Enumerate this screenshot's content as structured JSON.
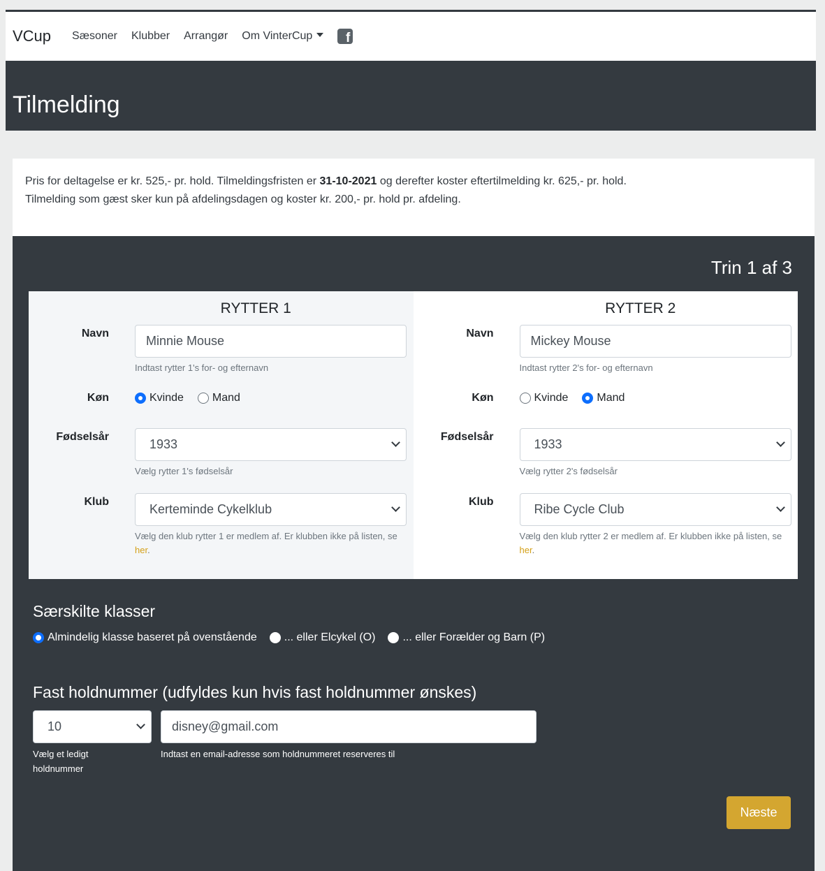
{
  "nav": {
    "brand": "VCup",
    "links": [
      "Sæsoner",
      "Klubber",
      "Arrangør",
      "Om VinterCup"
    ]
  },
  "page_title": "Tilmelding",
  "info": {
    "line1_pre": "Pris for deltagelse er kr. 525,- pr. hold. Tilmeldingsfristen er ",
    "deadline": "31-10-2021",
    "line1_post": " og derefter koster eftertilmelding kr. 625,- pr. hold.",
    "line2": "Tilmelding som gæst sker kun på afdelingsdagen og koster kr. 200,- pr. hold pr. afdeling."
  },
  "step": "Trin 1 af 3",
  "riders": [
    {
      "title": "RYTTER 1",
      "name_label": "Navn",
      "name_value": "Minnie Mouse",
      "name_help": "Indtast rytter 1's for- og efternavn",
      "gender_label": "Køn",
      "gender_options": [
        "Kvinde",
        "Mand"
      ],
      "gender_selected": "Kvinde",
      "year_label": "Fødselsår",
      "year_value": "1933",
      "year_help": "Vælg rytter 1's fødselsår",
      "club_label": "Klub",
      "club_value": "Kerteminde Cykelklub",
      "club_help_pre": "Vælg den klub rytter 1 er medlem af. Er klubben ikke på listen, se ",
      "club_help_link": "her",
      "club_help_post": "."
    },
    {
      "title": "RYTTER 2",
      "name_label": "Navn",
      "name_value": "Mickey Mouse",
      "name_help": "Indtast rytter 2's for- og efternavn",
      "gender_label": "Køn",
      "gender_options": [
        "Kvinde",
        "Mand"
      ],
      "gender_selected": "Mand",
      "year_label": "Fødselsår",
      "year_value": "1933",
      "year_help": "Vælg rytter 2's fødselsår",
      "club_label": "Klub",
      "club_value": "Ribe Cycle Club",
      "club_help_pre": "Vælg den klub rytter 2 er medlem af. Er klubben ikke på listen, se ",
      "club_help_link": "her",
      "club_help_post": "."
    }
  ],
  "classes": {
    "title": "Særskilte klasser",
    "options": [
      "Almindelig klasse baseret på ovenstående",
      "... eller Elcykel (O)",
      "... eller Forælder og Barn (P)"
    ],
    "selected": "Almindelig klasse baseret på ovenstående"
  },
  "team_number": {
    "title": "Fast holdnummer (udfyldes kun hvis fast holdnummer ønskes)",
    "number_value": "10",
    "number_help": "Vælg et ledigt holdnummer",
    "email_value": "disney@gmail.com",
    "email_help": "Indtast en email-adresse som holdnummeret reserveres til"
  },
  "next_button": "Næste",
  "icons": {
    "facebook": "facebook-icon",
    "dropdown": "caret-down-icon",
    "select": "chevron-down-icon"
  },
  "colors": {
    "dark": "#343a40",
    "accent": "#d4a630",
    "radio": "#0d6efd"
  }
}
